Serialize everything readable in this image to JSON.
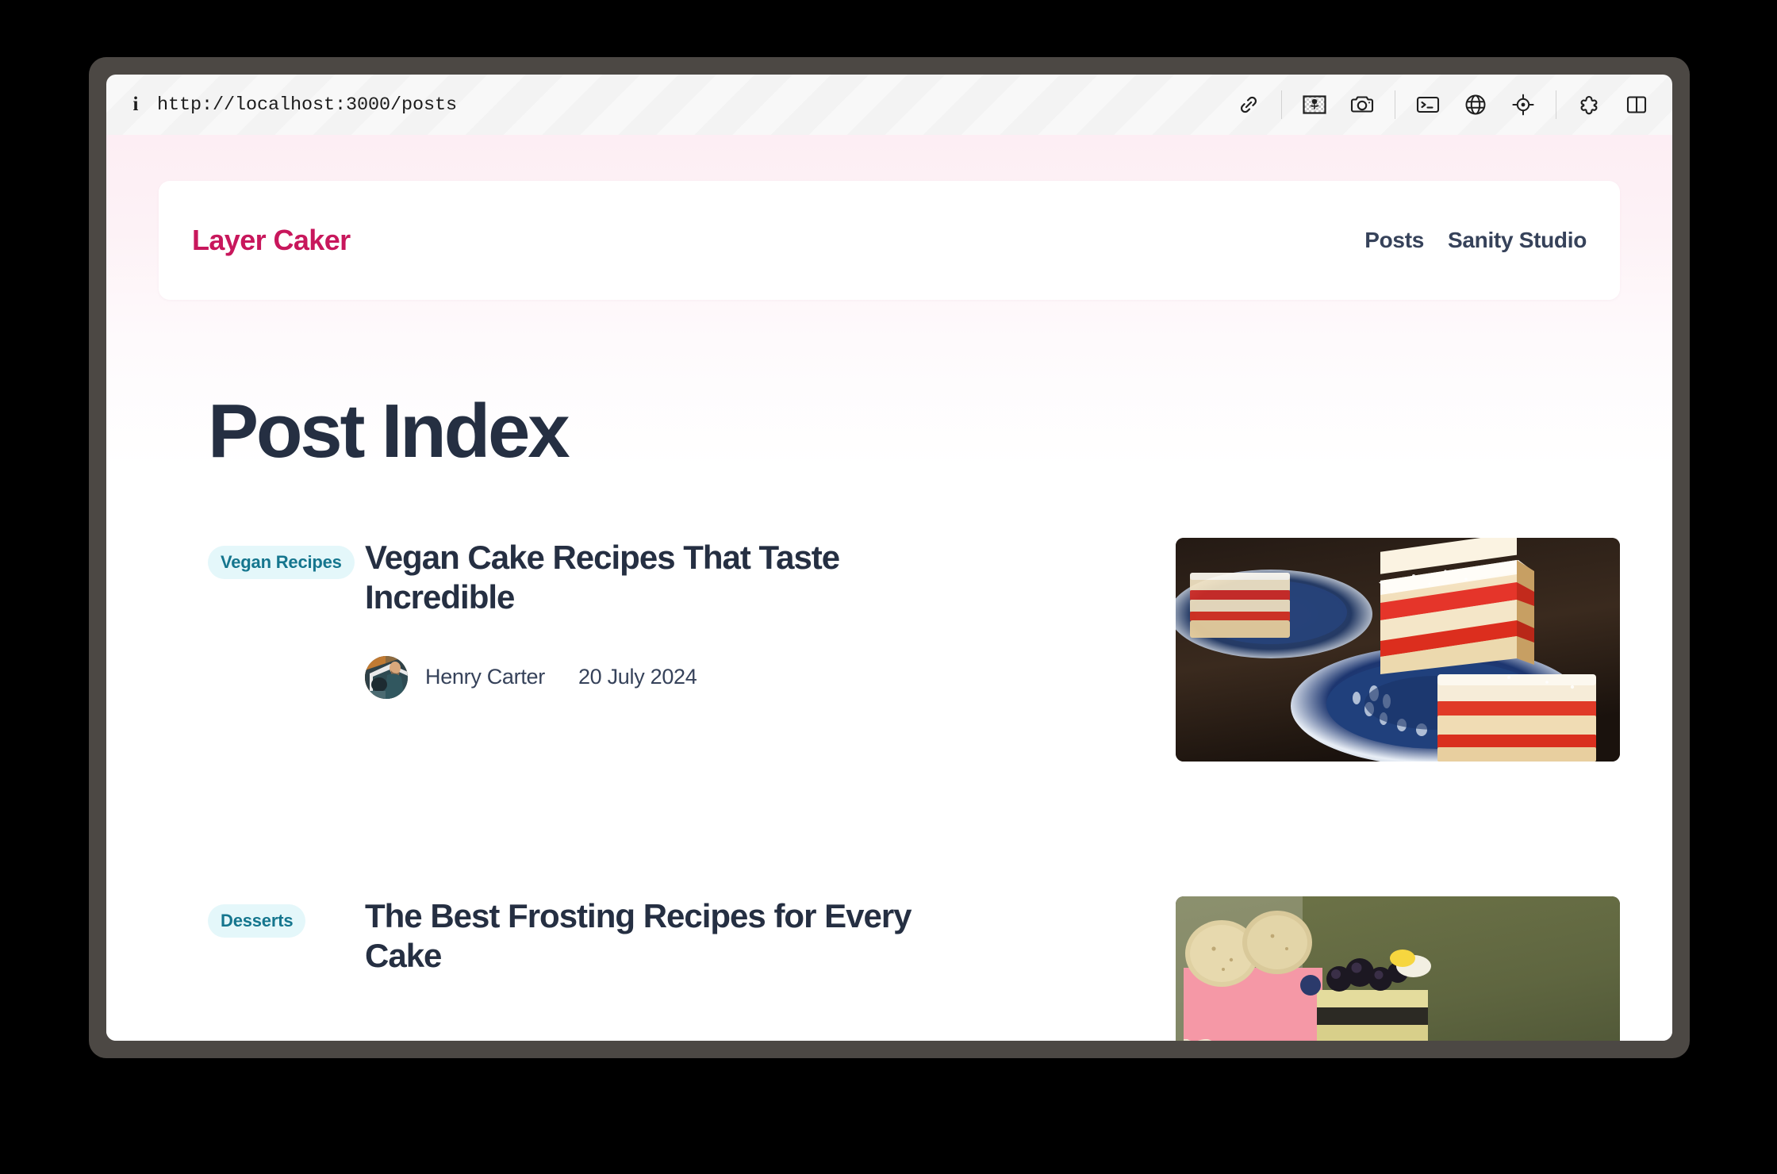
{
  "browser": {
    "url": "http://localhost:3000/posts",
    "info_icon": "info-icon",
    "toolbar_icons": [
      "link-icon",
      "image-icon",
      "camera-icon",
      "terminal-icon",
      "globe-icon",
      "target-icon",
      "puzzle-icon",
      "split-panel-icon"
    ]
  },
  "site": {
    "brand": "Layer Caker",
    "nav": [
      {
        "label": "Posts"
      },
      {
        "label": "Sanity Studio"
      }
    ]
  },
  "page": {
    "title": "Post Index"
  },
  "posts": [
    {
      "category": "Vegan Recipes",
      "title": "Vegan Cake Recipes That Taste Incredible",
      "author": "Henry Carter",
      "date": "20 July 2024",
      "thumb_alt": "layered-sponge-cake-photo"
    },
    {
      "category": "Desserts",
      "title": "The Best Frosting Recipes for Every Cake",
      "author": "",
      "date": "",
      "thumb_alt": "pink-frosted-cake-photo"
    }
  ],
  "colors": {
    "brand": "#c8175c",
    "text": "#252f42",
    "nav": "#36425a",
    "badge_bg": "#e4f7fa",
    "badge_text": "#15768e",
    "page_bg_top": "#fdeef4",
    "window_frame": "#4c4844"
  }
}
